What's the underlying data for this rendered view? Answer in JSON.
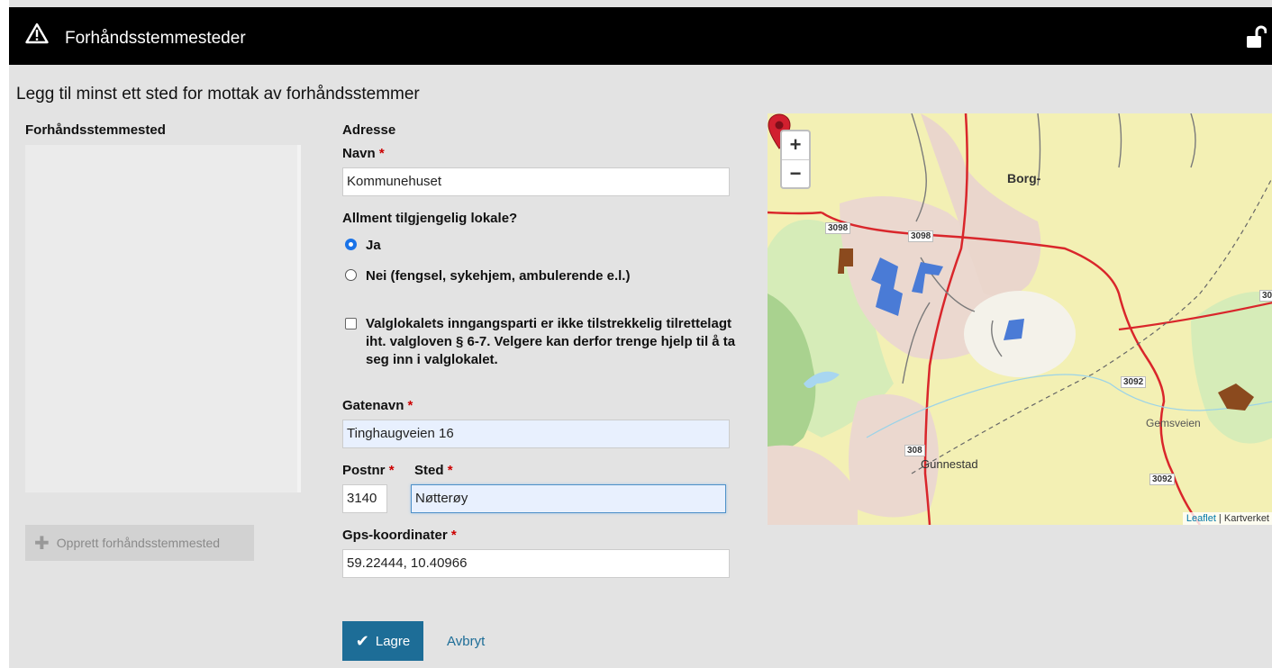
{
  "app": {
    "title": "Forhåndsstemmesteder"
  },
  "page": {
    "heading": "Legg til minst ett sted for mottak av forhåndsstemmer"
  },
  "list": {
    "label": "Forhåndsstemmested",
    "create_button": "Opprett forhåndsstemmested"
  },
  "form": {
    "section_title": "Adresse",
    "name": {
      "label": "Navn",
      "value": "Kommunehuset"
    },
    "public_question": "Allment tilgjengelig lokale?",
    "options": [
      {
        "label": "Ja",
        "selected": true
      },
      {
        "label": "Nei (fengsel, sykehjem, ambulerende e.l.)",
        "selected": false
      }
    ],
    "accessibility_checkbox": {
      "label": "Valglokalets inngangsparti er ikke tilstrekkelig tilrettelagt iht. valgloven § 6-7. Velgere kan derfor trenge hjelp til å ta seg inn i valglokalet.",
      "checked": false
    },
    "street": {
      "label": "Gatenavn",
      "value": "Tinghaugveien 16"
    },
    "postnr": {
      "label": "Postnr",
      "value": "3140"
    },
    "place": {
      "label": "Sted",
      "value": "Nøtterøy"
    },
    "gps": {
      "label": "Gps-koordinater",
      "value": "59.22444, 10.40966"
    },
    "required_mark": "*",
    "save_button": "Lagre",
    "cancel_link": "Avbryt"
  },
  "map": {
    "zoom_in": "+",
    "zoom_out": "−",
    "attribution_leaflet": "Leaflet",
    "attribution_sep": " | ",
    "attribution_source": "Kartverket",
    "labels": {
      "borg": "Borg-",
      "gunnestad": "Gunnestad",
      "gemsveien": "Gemsveien",
      "road_3098_a": "3098",
      "road_3098_b": "3098",
      "road_3092_a": "3092",
      "road_3092_b": "3092",
      "road_308": "308",
      "road_30": "30"
    }
  },
  "colors": {
    "topbar": "#000000",
    "primary": "#1d6d97",
    "required": "#cc0000",
    "background": "#e3e3e3"
  },
  "icons": {
    "warning": "warning-triangle-icon",
    "lock": "unlock-icon",
    "plus": "plus-icon",
    "check": "check-icon",
    "marker": "map-marker-icon"
  }
}
